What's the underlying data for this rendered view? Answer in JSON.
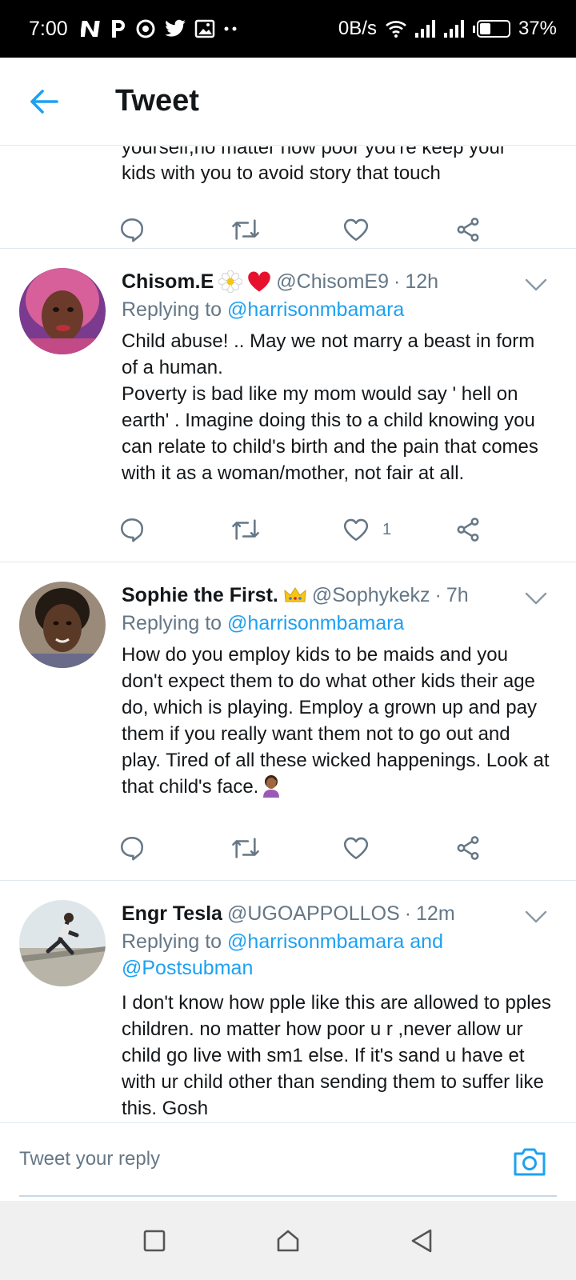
{
  "status_bar": {
    "time": "7:00",
    "data_rate": "0B/s",
    "battery_percent": "37%",
    "battery_level": 0.37,
    "notification_icons": [
      "netflix-icon",
      "p-icon",
      "vpn-icon",
      "twitter-icon",
      "image-icon",
      "more-dots-icon"
    ]
  },
  "header": {
    "title": "Tweet"
  },
  "partial_tweet": {
    "text_lines": [
      "yourself,no matter how poor you're keep your",
      "kids with you to avoid story that touch"
    ]
  },
  "tweets": [
    {
      "name": "Chisom.E",
      "emojis": [
        "flower-emoji",
        "heart-emoji"
      ],
      "handle": "@ChisomE9",
      "dot": "·",
      "time": "12h",
      "replying_label": "Replying to",
      "replying_to": "@harrisonmbamara",
      "body": "Child abuse! .. May we not marry a beast in form of a human.\nPoverty is bad  like my mom would say ' hell on earth' . Imagine doing this to a child knowing you can relate to child's birth and the pain that comes with it as a woman/mother, not fair at all.",
      "like_count": "1"
    },
    {
      "name": "Sophie the First.",
      "emojis": [
        "crown-emoji"
      ],
      "handle": "@Sophykekz",
      "dot": "·",
      "time": "7h",
      "replying_label": "Replying to",
      "replying_to": "@harrisonmbamara",
      "body": "How do you employ kids to be maids and you don't expect them to do what other kids their age do, which is playing. Employ a grown up and pay them if you really want them not to go out and play. Tired of all these wicked happenings. Look at that child's face.",
      "like_count": ""
    },
    {
      "name": "Engr Tesla",
      "emojis": [],
      "handle": "@UGOAPPOLLOS",
      "dot": "·",
      "time": "12m",
      "replying_label": "Replying to",
      "replying_to": "@harrisonmbamara and @Postsubman",
      "body": "I don't know how pple like this are allowed to pples children. no matter how poor u r ,never allow ur child go live with sm1 else. If it's sand u have et with ur child other than sending them to suffer like this. Gosh",
      "like_count": ""
    }
  ],
  "reply_bar": {
    "placeholder": "Tweet your reply"
  },
  "colors": {
    "accent": "#1da1f2",
    "secondary_text": "#657786",
    "divider": "#e1e8ed"
  }
}
